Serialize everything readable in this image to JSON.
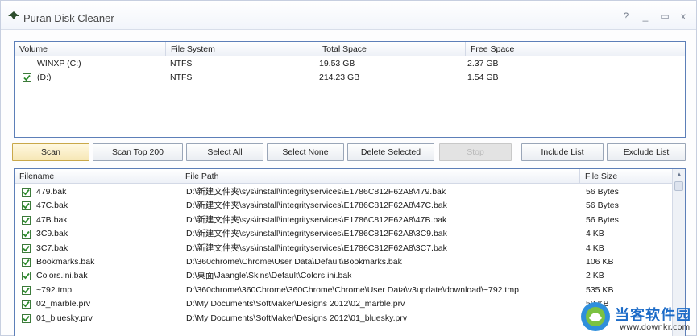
{
  "window": {
    "title": "Puran Disk Cleaner",
    "controls": [
      "?",
      "_",
      "▭",
      "x"
    ]
  },
  "volumes": {
    "columns": [
      "Volume",
      "File System",
      "Total Space",
      "Free Space"
    ],
    "rows": [
      {
        "checked": false,
        "volume": "WINXP (C:)",
        "fs": "NTFS",
        "total": "19.53 GB",
        "free": "2.37 GB"
      },
      {
        "checked": true,
        "volume": "(D:)",
        "fs": "NTFS",
        "total": "214.23 GB",
        "free": "1.54 GB"
      }
    ]
  },
  "toolbar": {
    "scan": "Scan",
    "scan_top": "Scan Top 200",
    "select_all": "Select All",
    "select_none": "Select None",
    "delete_selected": "Delete Selected",
    "stop": "Stop",
    "include_list": "Include List",
    "exclude_list": "Exclude List"
  },
  "files": {
    "columns": [
      "Filename",
      "File Path",
      "File Size"
    ],
    "rows": [
      {
        "checked": true,
        "name": "479.bak",
        "path": "D:\\新建文件夹\\sys\\install\\integrityservices\\E1786C812F62A8\\479.bak",
        "size": "56 Bytes"
      },
      {
        "checked": true,
        "name": "47C.bak",
        "path": "D:\\新建文件夹\\sys\\install\\integrityservices\\E1786C812F62A8\\47C.bak",
        "size": "56 Bytes"
      },
      {
        "checked": true,
        "name": "47B.bak",
        "path": "D:\\新建文件夹\\sys\\install\\integrityservices\\E1786C812F62A8\\47B.bak",
        "size": "56 Bytes"
      },
      {
        "checked": true,
        "name": "3C9.bak",
        "path": "D:\\新建文件夹\\sys\\install\\integrityservices\\E1786C812F62A8\\3C9.bak",
        "size": "4 KB"
      },
      {
        "checked": true,
        "name": "3C7.bak",
        "path": "D:\\新建文件夹\\sys\\install\\integrityservices\\E1786C812F62A8\\3C7.bak",
        "size": "4 KB"
      },
      {
        "checked": true,
        "name": "Bookmarks.bak",
        "path": "D:\\360chrome\\Chrome\\User Data\\Default\\Bookmarks.bak",
        "size": "106 KB"
      },
      {
        "checked": true,
        "name": "Colors.ini.bak",
        "path": "D:\\桌面\\Jaangle\\Skins\\Default\\Colors.ini.bak",
        "size": "2 KB"
      },
      {
        "checked": true,
        "name": "~792.tmp",
        "path": "D:\\360chrome\\360Chrome\\360Chrome\\Chrome\\User Data\\v3update\\download\\~792.tmp",
        "size": "535 KB"
      },
      {
        "checked": true,
        "name": "02_marble.prv",
        "path": "D:\\My Documents\\SoftMaker\\Designs 2012\\02_marble.prv",
        "size": "59 KB"
      },
      {
        "checked": true,
        "name": "01_bluesky.prv",
        "path": "D:\\My Documents\\SoftMaker\\Designs 2012\\01_bluesky.prv",
        "size": "43 KB"
      }
    ]
  },
  "watermark": {
    "text": "当客软件园",
    "url": "www.downkr.com"
  }
}
